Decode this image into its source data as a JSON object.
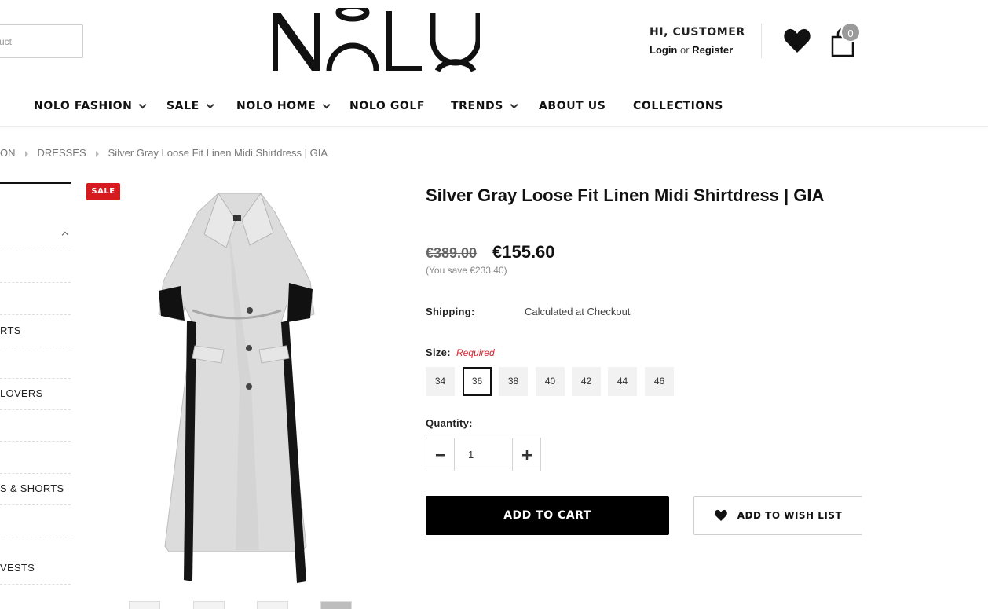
{
  "search": {
    "placeholder": "uct"
  },
  "header": {
    "greeting": "HI, CUSTOMER",
    "login": "Login",
    "or": "or",
    "register": "Register",
    "cart_count": "0"
  },
  "nav": [
    {
      "label": "NOLO FASHION",
      "dropdown": true
    },
    {
      "label": "SALE",
      "dropdown": true
    },
    {
      "label": "NOLO HOME",
      "dropdown": true
    },
    {
      "label": "NOLO GOLF",
      "dropdown": false
    },
    {
      "label": "TRENDS",
      "dropdown": true
    },
    {
      "label": "ABOUT US",
      "dropdown": false
    },
    {
      "label": "COLLECTIONS",
      "dropdown": false
    }
  ],
  "breadcrumb": [
    "ON",
    "DRESSES",
    "Silver Gray Loose Fit Linen Midi Shirtdress | GIA"
  ],
  "sidebar": [
    "RTS",
    "LOVERS",
    "S & SHORTS",
    "VESTS"
  ],
  "product": {
    "badge": "SALE",
    "title": "Silver Gray Loose Fit Linen Midi Shirtdress | GIA",
    "price_old": "€389.00",
    "price_new": "€155.60",
    "you_save": "(You save €233.40)",
    "shipping_label": "Shipping:",
    "shipping_value": "Calculated at Checkout",
    "size_label": "Size:",
    "size_required": "Required",
    "sizes": [
      "34",
      "36",
      "38",
      "40",
      "42",
      "44",
      "46"
    ],
    "selected_size": "36",
    "quantity_label": "Quantity:",
    "quantity": "1",
    "add_to_cart": "ADD TO CART",
    "add_to_wishlist": "ADD TO WISH LIST"
  },
  "colors": {
    "sale_red": "#d71920",
    "accent": "#000000",
    "required": "#d7262d"
  }
}
